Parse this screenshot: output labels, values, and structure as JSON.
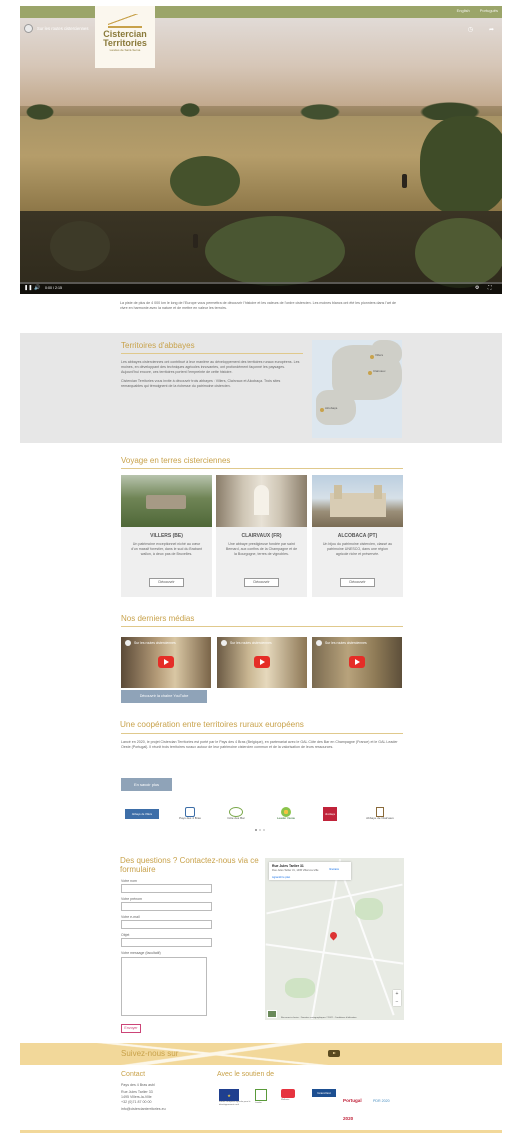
{
  "header": {
    "languages": [
      "English",
      "Português"
    ],
    "logo": {
      "line1": "Cistercian",
      "line2": "Territories",
      "line3": "Landes de Saint-Serna"
    },
    "video_title": "Sur les routes cisterciennes",
    "icons": [
      "clock-icon",
      "share-icon"
    ]
  },
  "player": {
    "play_glyph": "❚❚",
    "mute_glyph": "🔊",
    "time": "0:00 / 2:15",
    "settings_glyph": "⚙",
    "fullscreen_glyph": "⛶",
    "progress": 0
  },
  "intro": {
    "text": "La piste de plus de 4 000 km le long de l'Europe vous permettra de découvrir l'histoire et les valeurs de l'ordre cistercien. Les moines blancs ont été les pionniers dans l'art de vivre en harmonie avec la nature et de mettre en valeur les terroirs."
  },
  "abbeys": {
    "title": "Territoires d'abbayes",
    "text1": "Les abbayes cisterciennes ont contribué à leur manière au développement des territoires ruraux européens. Les moines, en développant des techniques agricoles innovantes, ont profondément façonné les paysages. Aujourd'hui encore, ces territoires portent l'empreinte de cette histoire.",
    "text2": "Cistercian Territories vous invite à découvrir trois abbayes : Villers, Clairvaux et Alcobaça. Trois sites remarquables qui témoignent de la richesse du patrimoine cistercien.",
    "map_labels": [
      "Villers",
      "Clairvaux",
      "Alcobaça"
    ]
  },
  "journey": {
    "title": "Voyage en terres cisterciennes",
    "cards": [
      {
        "title": "VILLERS (BE)",
        "desc": "Un patrimoine exceptionnel niché au cœur d'un massif forestier, dans le sud du Brabant wallon, à deux pas de Bruxelles.",
        "button": "Découvrir"
      },
      {
        "title": "CLAIRVAUX (FR)",
        "desc": "Une abbaye prestigieuse fondée par saint Bernard, aux confins de la Champagne et de la Bourgogne, terres de vignobles.",
        "button": "Découvrir"
      },
      {
        "title": "ALCOBACA (PT)",
        "desc": "Un bijou du patrimoine cistercien, classé au patrimoine UNESCO, dans une région agricole riche et préservée.",
        "button": "Découvrir"
      }
    ]
  },
  "media": {
    "title": "Nos derniers médias",
    "videos": [
      {
        "title": "Sur les routes cisterciennes"
      },
      {
        "title": "Sur les routes cisterciennes"
      },
      {
        "title": "Sur les routes cisterciennes"
      }
    ],
    "channel_button": "Découvrir la chaîne YouTube"
  },
  "cooperation": {
    "title": "Une coopération entre territoires ruraux européens",
    "text": "Lancé en 2020, le projet Cistercian Territories est porté par le Pays des 4 Bras (Belgique), en partenariat avec le GAL Côte des Bar en Champagne (France) et le GAL Leader Oeste (Portugal). Il réunit trois territoires ruraux autour de leur patrimoine cistercien commun et de la valorisation de leurs ressources.",
    "more_button": "En savoir plus",
    "partners": [
      "Abbaye de Villers",
      "Pays des 4 Bras",
      "Côte des Bar",
      "Leader Oeste",
      "Alcobaça",
      "Abbaye de Clairvaux"
    ]
  },
  "contact_form": {
    "title": "Des questions ? Contactez-nous via ce formulaire",
    "fields": [
      "Votre nom",
      "Votre prénom",
      "Votre e-mail",
      "Objet",
      "Votre message (facultatif)"
    ],
    "submit": "Envoyer"
  },
  "gmap": {
    "place": "Rue Jules Tarlier 31",
    "address": "Rue Jules Tarlier 31, 1495 Villers-la-Ville",
    "route_label": "Itinéraire",
    "bigger_map": "Agrandir le plan",
    "zoom_in": "+",
    "zoom_out": "−",
    "attribution": "Raccourcis clavier · Données cartographiques ©2022 · Conditions d'utilisation"
  },
  "footer": {
    "follow": "Suivez-nous sur",
    "contact_title": "Contact",
    "contact_lines": [
      "Pays des 4 Bras asbl",
      "Rue Jules Tarlier 33",
      "1495 Villers-la-Ville",
      "+32 (0)71 87 00 00",
      "info@cistercianterritories.eu"
    ],
    "support_title": "Avec le soutien de",
    "supporters": [
      "Fonds européen agricole pour le développement rural",
      "Leader",
      "Wallonie",
      "Grand Est",
      "Portugal 2020",
      "PDR 2020"
    ]
  },
  "colors": {
    "accent": "#c8a24b",
    "topbar": "#9ba56a",
    "button": "#8fa3b8",
    "band": "#f2d89a"
  }
}
